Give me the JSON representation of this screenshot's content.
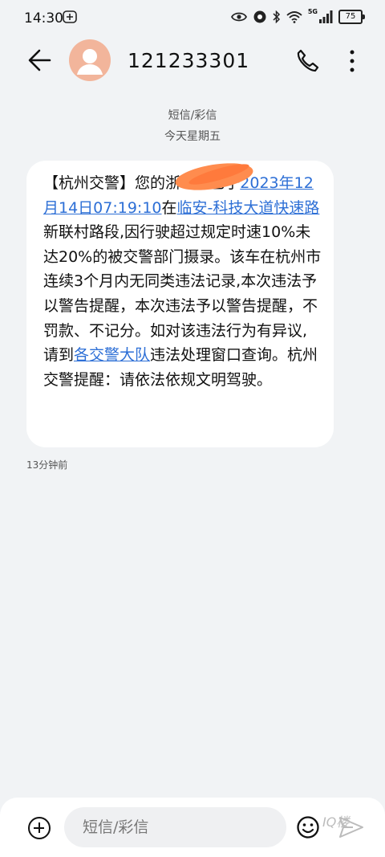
{
  "status": {
    "time": "14:30",
    "battery": "75",
    "network": "5G"
  },
  "header": {
    "title": "121233301"
  },
  "conversation": {
    "service": "短信/彩信",
    "date": "今天星期五"
  },
  "message": {
    "segments": [
      {
        "text": "【杭州交警】您的浙",
        "link": false
      },
      {
        "text": "已于",
        "link": false
      },
      {
        "text": "2023年12月14日07:19:10",
        "link": true
      },
      {
        "text": "在",
        "link": false
      },
      {
        "text": "临安-科技大道快速路",
        "link": true
      },
      {
        "text": "新联村路段,因行驶超过规定时速10%未达20%的被交警部门摄录。该车在杭州市连续3个月内无同类违法记录,本次违法予以警告提醒，本次违法予以警告提醒，不罚款、不记分。如对该违法行为有异议,请到",
        "link": false
      },
      {
        "text": "各交警大队",
        "link": true
      },
      {
        "text": "违法处理窗口查询。杭州交警提醒：请依法依规文明驾驶。",
        "link": false
      }
    ],
    "time_ago": "13分钟前"
  },
  "composer": {
    "placeholder": "短信/彩信"
  },
  "watermark": "IQ楼",
  "colors": {
    "link": "#2d6fd6",
    "background": "#f1f3f5",
    "avatar": "#f2b59b"
  }
}
